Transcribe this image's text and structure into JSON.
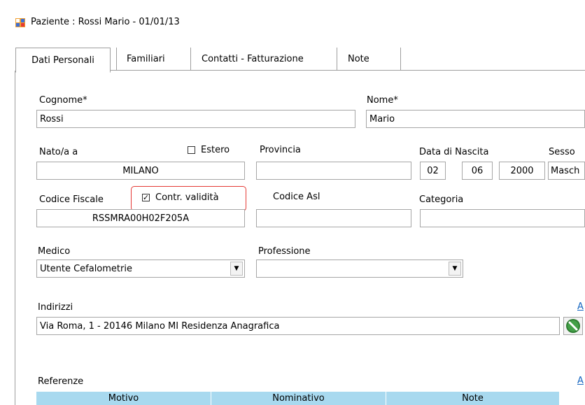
{
  "window": {
    "title": "Paziente : Rossi Mario - 01/01/13"
  },
  "tabs": [
    {
      "label": "Dati Personali",
      "active": true
    },
    {
      "label": "Familiari"
    },
    {
      "label": "Contatti - Fatturazione"
    },
    {
      "label": "Note"
    }
  ],
  "form": {
    "cognome": {
      "label": "Cognome*",
      "value": "Rossi"
    },
    "nome": {
      "label": "Nome*",
      "value": "Mario"
    },
    "nato_a": {
      "label": "Nato/a a",
      "value": "MILANO"
    },
    "estero": {
      "label": "Estero",
      "checked": false
    },
    "provincia": {
      "label": "Provincia",
      "value": ""
    },
    "data_nascita": {
      "label": "Data di Nascita",
      "day": "02",
      "month": "06",
      "year": "2000"
    },
    "sesso": {
      "label": "Sesso",
      "value": "Masch"
    },
    "codice_fiscale": {
      "label": "Codice Fiscale",
      "value": "RSSMRA00H02F205A"
    },
    "contr_validita": {
      "label": "Contr. validità",
      "checked": true
    },
    "codice_asl": {
      "label": "Codice Asl",
      "value": ""
    },
    "categoria": {
      "label": "Categoria",
      "value": ""
    },
    "medico": {
      "label": "Medico",
      "value": "Utente Cefalometrie"
    },
    "professione": {
      "label": "Professione",
      "value": ""
    },
    "indirizzi": {
      "label": "Indirizzi",
      "value": "Via Roma, 1 - 20146 Milano MI Residenza Anagrafica",
      "link": "A"
    }
  },
  "referenze": {
    "label": "Referenze",
    "link": "A",
    "columns": [
      "Motivo",
      "Nominativo",
      "Note"
    ]
  },
  "colors": {
    "highlight": "#e53935",
    "header_bg": "#a8d9ef",
    "link": "#1565c0"
  }
}
